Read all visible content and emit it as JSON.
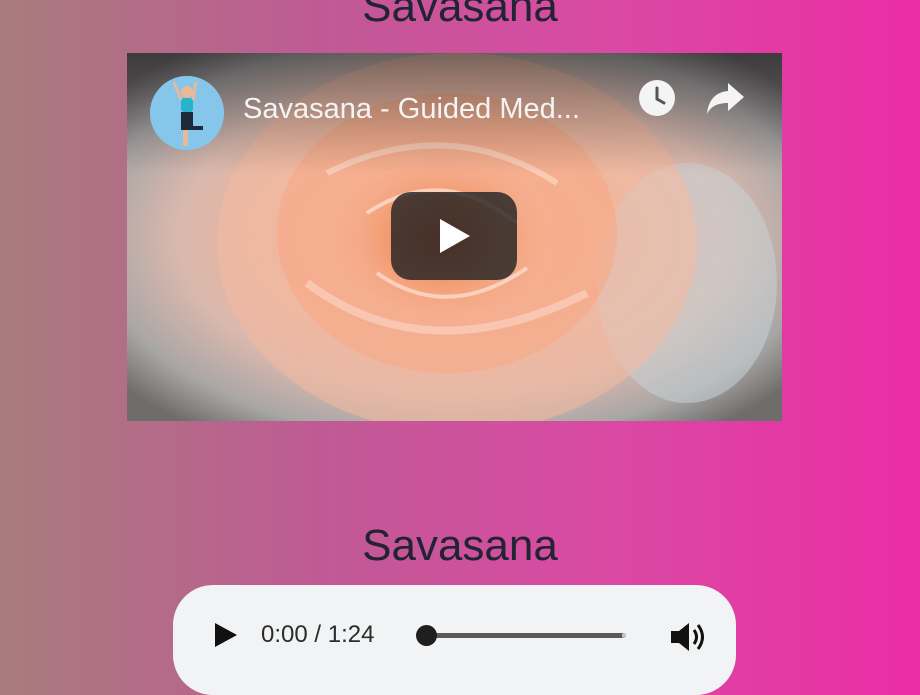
{
  "sections": [
    {
      "title": "Savasana",
      "video": {
        "title": "Savasana - Guided Med...",
        "icons": {
          "avatar": "channel-avatar",
          "clock": "watch-later-icon",
          "share": "share-icon",
          "play": "play-icon"
        }
      }
    },
    {
      "title": "Savasana",
      "audio": {
        "time": "0:00 / 1:24",
        "progress": 0,
        "icons": {
          "play": "play-icon",
          "volume": "volume-icon"
        }
      }
    }
  ],
  "colors": {
    "gradient_start": "#a87c7c",
    "gradient_end": "#eb2da5",
    "audio_bg": "#f1f3f4"
  }
}
